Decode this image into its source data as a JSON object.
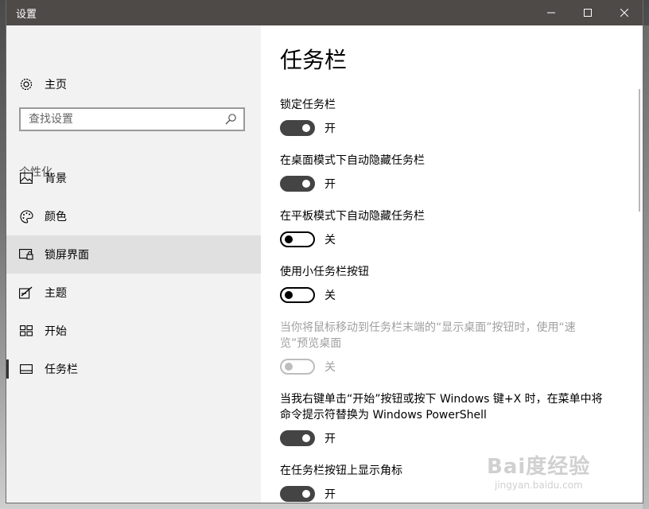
{
  "window": {
    "title": "设置",
    "controls": {
      "minimize": "minimize",
      "maximize": "maximize",
      "close": "close"
    }
  },
  "sidebar": {
    "home_label": "主页",
    "search": {
      "placeholder": "查找设置",
      "value": ""
    },
    "section_label": "个性化",
    "items": [
      {
        "label": "背景",
        "icon": "picture-icon"
      },
      {
        "label": "颜色",
        "icon": "palette-icon"
      },
      {
        "label": "锁屏界面",
        "icon": "lock-screen-icon",
        "hovered": true
      },
      {
        "label": "主题",
        "icon": "theme-icon"
      },
      {
        "label": "开始",
        "icon": "start-icon"
      },
      {
        "label": "任务栏",
        "icon": "taskbar-icon",
        "active": true
      }
    ]
  },
  "main": {
    "title": "任务栏",
    "settings": [
      {
        "label": "锁定任务栏",
        "state": "开",
        "on": true
      },
      {
        "label": "在桌面模式下自动隐藏任务栏",
        "state": "开",
        "on": true
      },
      {
        "label": "在平板模式下自动隐藏任务栏",
        "state": "关",
        "on": false
      },
      {
        "label": "使用小任务栏按钮",
        "state": "关",
        "on": false
      },
      {
        "label_line1": "当你将鼠标移动到任务栏末端的“显示桌面”按钮时，使用“速",
        "label_line2": "览”预览桌面",
        "state": "关",
        "on": false,
        "disabled": true
      },
      {
        "label_line1": "当我右键单击“开始”按钮或按下 Windows 键+X 时，在菜单中将",
        "label_line2": "命令提示符替换为 Windows PowerShell",
        "state": "开",
        "on": true
      },
      {
        "label": "在任务栏按钮上显示角标",
        "state": "开",
        "on": true
      }
    ]
  },
  "watermark": {
    "text": "Bai度经验",
    "sub": "jingyan.baidu.com"
  },
  "colors": {
    "titlebar": "#4d4a48",
    "sidebar_bg": "#f2f2f2",
    "selected_bg": "#e0e0e0",
    "toggle_on": "#444444",
    "disabled_text": "#a0a0a0"
  }
}
